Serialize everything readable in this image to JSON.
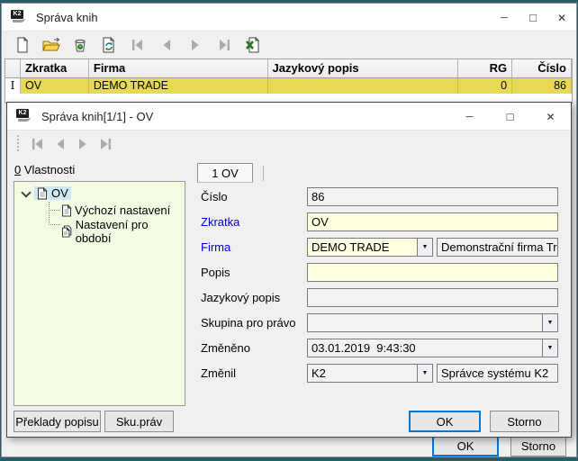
{
  "main_window": {
    "title": "Správa knih",
    "app_badge": "K2",
    "toolbar_icons": [
      "new-document",
      "open-folder",
      "recycle-bin",
      "refresh-document",
      "nav-first",
      "nav-prev",
      "nav-next",
      "nav-last",
      "excel-export"
    ],
    "grid": {
      "columns": [
        {
          "label": "Zkratka"
        },
        {
          "label": "Firma"
        },
        {
          "label": "Jazykový popis"
        },
        {
          "label": "RG"
        },
        {
          "label": "Číslo"
        }
      ],
      "row": {
        "indicator": "I",
        "zkratka": "OV",
        "firma": "DEMO TRADE",
        "jazykovy_popis": "",
        "rg": "0",
        "cislo": "86"
      }
    },
    "footer": {
      "ok": "OK",
      "storno": "Storno"
    }
  },
  "dialog": {
    "title": "Správa knih[1/1] - OV",
    "app_badge": "K2",
    "properties": {
      "accel": "0",
      "label": " Vlastnosti"
    },
    "tree": {
      "root": "OV",
      "children": [
        "Výchozí nastavení",
        "Nastavení pro období"
      ]
    },
    "tab": "1 OV",
    "fields": {
      "cislo": {
        "label": "Číslo",
        "value": "86"
      },
      "zkratka": {
        "label": "Zkratka",
        "value": "OV"
      },
      "firma": {
        "label": "Firma",
        "value": "DEMO TRADE",
        "value2": "Demonstrační firma Trade,"
      },
      "popis": {
        "label": "Popis",
        "value": ""
      },
      "jazykovy": {
        "label": "Jazykový popis",
        "value": ""
      },
      "skupina": {
        "label": "Skupina pro právo",
        "value": ""
      },
      "zmeneno": {
        "label": "Změněno",
        "value": "03.01.2019  9:43:30"
      },
      "zmenil": {
        "label": "Změnil",
        "value": "K2",
        "value2": "Správce systému K2"
      }
    },
    "buttons": {
      "preklady": "Překlady popisu",
      "sku_prav": "Sku.práv",
      "ok": "OK",
      "storno": "Storno"
    }
  },
  "colors": {
    "row_highlight": "#e6da55",
    "editable_bg": "#ffffe1",
    "readonly_bg": "#f2f2f2",
    "tree_bg": "#f3fbe3",
    "blue_label": "#0000c8",
    "focus_border": "#0078d7"
  }
}
